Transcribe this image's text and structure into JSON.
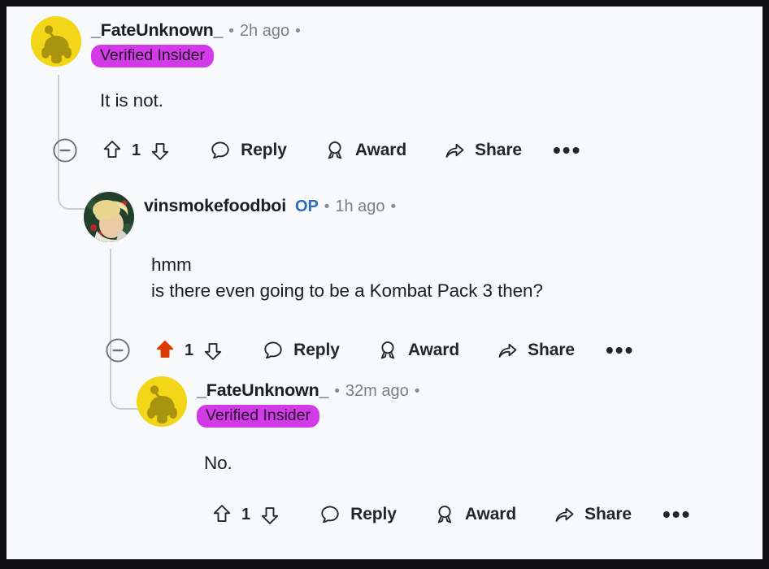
{
  "app": {
    "platform": "reddit-comment-thread",
    "background_color": "#F8F9FA",
    "frame_color": "#111113",
    "accent_upvote_color": "#D93A00",
    "flair_color": "#D43BE8",
    "op_color": "#2C6EBE",
    "thread_line_color": "#CBCDD0"
  },
  "icons": {
    "collapse": "minus-circle-icon",
    "upvote": "upvote-arrow-icon",
    "downvote": "downvote-arrow-icon",
    "reply": "speech-bubble-icon",
    "award": "award-medal-icon",
    "share": "share-arrow-icon",
    "more": "more-options-icon"
  },
  "comments": [
    {
      "id": "comment-1",
      "depth": 0,
      "author": "_FateUnknown_",
      "avatar_type": "snoo-avatar",
      "avatar_color": "#F3D617",
      "is_op": false,
      "op_label": "",
      "flair": "Verified Insider",
      "timestamp": "2h ago",
      "separator": "•",
      "body": "It is not.",
      "score": "1",
      "upvoted": false,
      "has_collapse": true,
      "actions": {
        "reply": "Reply",
        "award": "Award",
        "share": "Share",
        "more": "•••"
      }
    },
    {
      "id": "comment-2",
      "depth": 1,
      "author": "vinsmokefoodboi",
      "avatar_type": "photo-avatar",
      "avatar_color": "#2C4434",
      "is_op": true,
      "op_label": "OP",
      "flair": "",
      "timestamp": "1h ago",
      "separator": "•",
      "body": "hmm\nis there even going to be a Kombat Pack 3 then?",
      "score": "1",
      "upvoted": true,
      "has_collapse": true,
      "actions": {
        "reply": "Reply",
        "award": "Award",
        "share": "Share",
        "more": "•••"
      }
    },
    {
      "id": "comment-3",
      "depth": 2,
      "author": "_FateUnknown_",
      "avatar_type": "snoo-avatar",
      "avatar_color": "#F3D617",
      "is_op": false,
      "op_label": "",
      "flair": "Verified Insider",
      "timestamp": "32m ago",
      "separator": "•",
      "body": "No.",
      "score": "1",
      "upvoted": false,
      "has_collapse": false,
      "actions": {
        "reply": "Reply",
        "award": "Award",
        "share": "Share",
        "more": "•••"
      }
    }
  ]
}
